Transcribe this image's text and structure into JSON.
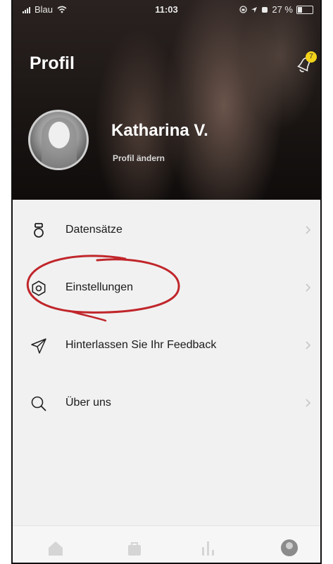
{
  "status_bar": {
    "carrier": "Blau",
    "time": "11:03",
    "battery_text": "27 %"
  },
  "header": {
    "title": "Profil",
    "notification_badge": "7"
  },
  "profile": {
    "name": "Katharina V.",
    "edit_label": "Profil ändern"
  },
  "menu": {
    "items": [
      {
        "label": "Datensätze",
        "icon": "medal-icon"
      },
      {
        "label": "Einstellungen",
        "icon": "settings-icon"
      },
      {
        "label": "Hinterlassen Sie Ihr Feedback",
        "icon": "send-icon"
      },
      {
        "label": "Über uns",
        "icon": "search-icon"
      }
    ]
  },
  "tab_bar": {
    "items": [
      "home-icon",
      "bag-icon",
      "stats-icon",
      "avatar-tab-icon"
    ]
  },
  "colors": {
    "annotation": "#c0262b",
    "badge": "#f3d21a"
  }
}
